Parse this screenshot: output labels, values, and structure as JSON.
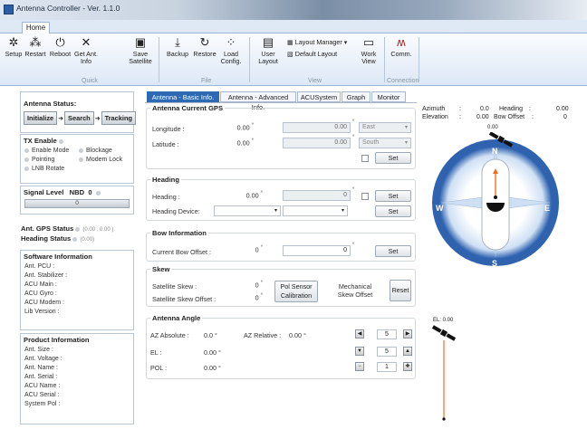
{
  "window": {
    "title": "Antenna Controller - Ver. 1.1.0"
  },
  "ribbon": {
    "tab": "Home",
    "buttons": [
      {
        "label": "Setup",
        "icon": "gear-icon"
      },
      {
        "label": "Restart",
        "icon": "restart-icon"
      },
      {
        "label": "Reboot",
        "icon": "power-icon"
      },
      {
        "label": "Get Ant. Info",
        "icon": "satellite-dish-icon"
      },
      {
        "label": "Save Satellite",
        "icon": "save-icon"
      },
      {
        "label": "Backup",
        "icon": "backup-icon"
      },
      {
        "label": "Restore",
        "icon": "restore-icon"
      },
      {
        "label": "Load Config.",
        "icon": "load-config-icon"
      },
      {
        "label": "User Layout",
        "icon": "user-layout-icon"
      },
      {
        "label": "Work View",
        "icon": "work-view-icon"
      },
      {
        "label": "Comm.",
        "icon": "comm-icon"
      }
    ],
    "layout_manager": "Layout Manager",
    "default_layout": "Default Layout",
    "groups": {
      "quick": "Quick",
      "file": "File",
      "view": "View",
      "connection": "Connection"
    }
  },
  "left": {
    "antenna_status": {
      "title": "Antenna Status:",
      "steps": [
        "Initialize",
        "Search",
        "Tracking"
      ]
    },
    "tx": {
      "title": "TX Enable",
      "items": [
        "Enable Mode",
        "Blockage",
        "Pointing",
        "Modem Lock",
        "LNB Rotate"
      ]
    },
    "signal": {
      "title": "Signal Level",
      "mode": "NBD",
      "value": "0",
      "bar_value": "0"
    },
    "gps_status": {
      "label": "Ant. GPS Status",
      "value": "(0.00 , 0.00 )"
    },
    "heading_status": {
      "label": "Heading Status",
      "value": "(0.00)"
    },
    "software": {
      "title": "Software Information",
      "items": [
        "Ant. PCU :",
        "Ant. Stabilizer :",
        "ACU Main :",
        "ACU Gyro :",
        "ACU Modem :",
        "Lib Version :"
      ]
    },
    "product": {
      "title": "Product Information",
      "items": [
        "Ant. Size :",
        "Ant. Voltage :",
        "Ant. Name :",
        "Ant. Serial :",
        "ACU Name :",
        "ACU Serial :",
        "System Pol :"
      ]
    }
  },
  "tabs": [
    "Antenna - Basic Info.",
    "Antenna - Advanced Info.",
    "ACUSystem",
    "Graph",
    "Monitor"
  ],
  "gps": {
    "title": "Antenna Current GPS",
    "longitude_label": "Longitude :",
    "longitude_value": "0.00",
    "latitude_label": "Latitude :",
    "latitude_value": "0.00",
    "longitude_input": "0.00",
    "latitude_input": "0.00",
    "ew": "East",
    "ns": "South",
    "set": "Set"
  },
  "heading": {
    "title": "Heading",
    "heading_label": "Heading :",
    "heading_value": "0.00",
    "heading_input": "0",
    "device_label": "Heading Device:",
    "set": "Set"
  },
  "bow": {
    "title": "Bow Information",
    "label": "Current Bow Offset :",
    "value": "0",
    "input": "0",
    "set": "Set"
  },
  "skew": {
    "title": "Skew",
    "sat_skew_label": "Satellite Skew :",
    "sat_skew_value": "0",
    "sat_skew_offset_label": "Satellite Skew Offset :",
    "sat_skew_offset_value": "0",
    "pol_sensor": "Pol Sensor Calibration",
    "mech_label": "Mechanical Skew Offset",
    "reset": "Reset"
  },
  "angle": {
    "title": "Antenna Angle",
    "az_abs_label": "AZ Absolute :",
    "az_abs_value": "0.0",
    "az_rel_label": "AZ Relative :",
    "az_rel_value": "0.00",
    "el_label": "EL :",
    "el_value": "0.00",
    "pol_label": "POL :",
    "pol_value": "0.00",
    "step_az": "5",
    "step_el": "5",
    "step_pol": "1"
  },
  "monitor": {
    "azimuth_label": "Azimuth",
    "azimuth_value": "0.0",
    "heading_label": "Heading",
    "heading_value": "0.00",
    "elevation_label": "Elevation",
    "elevation_value": "0.00",
    "bow_label": "Bow Offset",
    "bow_value": "0",
    "compass_marker": "0.00",
    "el_marker": "EL: 0.00",
    "compass_letters": {
      "n": "N",
      "s": "S",
      "e": "E",
      "w": "W"
    }
  }
}
